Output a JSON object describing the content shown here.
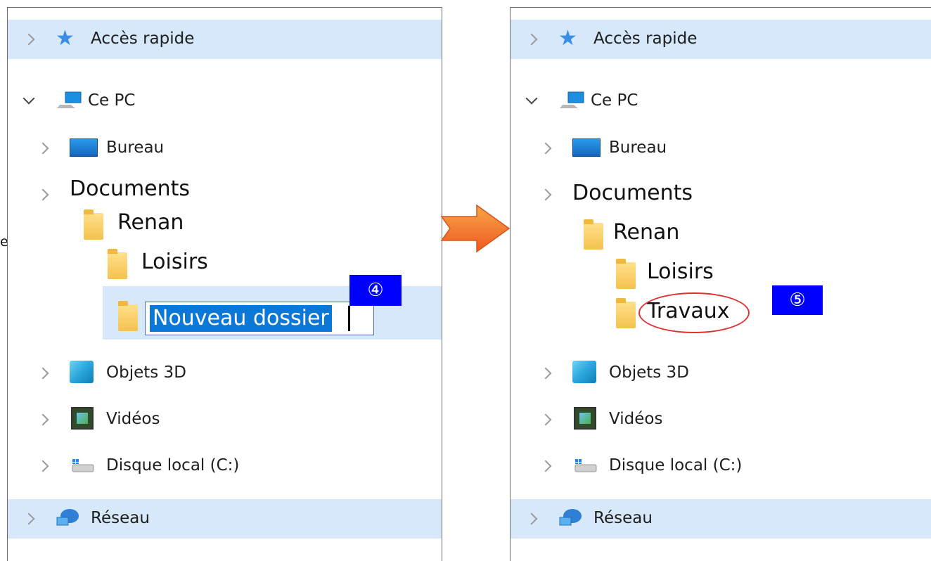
{
  "left_fragment": "ecalé.",
  "left": {
    "quick_access": "Accès rapide",
    "this_pc": "Ce PC",
    "desktop": "Bureau",
    "documents": "Documents",
    "renan": "Renan",
    "loisirs": "Loisirs",
    "new_folder": "Nouveau dossier",
    "objects3d": "Objets 3D",
    "videos": "Vidéos",
    "local_disk": "Disque local (C:)",
    "network": "Réseau",
    "step_badge": "④"
  },
  "right": {
    "quick_access": "Accès rapide",
    "this_pc": "Ce PC",
    "desktop": "Bureau",
    "documents": "Documents",
    "renan": "Renan",
    "loisirs": "Loisirs",
    "travaux": "Travaux",
    "objects3d": "Objets 3D",
    "videos": "Vidéos",
    "local_disk": "Disque local (C:)",
    "network": "Réseau",
    "step_badge": "⑤"
  },
  "colors": {
    "selection_band": "#d6e8f9",
    "badge": "#0000ff",
    "arrow_fill": "#f26522",
    "highlight_oval": "#e03030"
  },
  "icons": {
    "quick_access": "star-icon",
    "this_pc": "computer-icon",
    "desktop": "desktop-icon",
    "folder": "folder-icon",
    "objects3d": "cube-icon",
    "videos": "film-icon",
    "local_disk": "drive-icon",
    "network": "network-icon"
  }
}
